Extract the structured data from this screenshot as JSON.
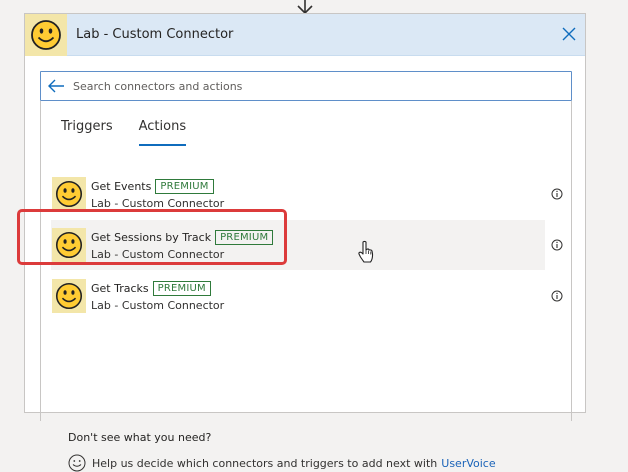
{
  "header": {
    "title": "Lab - Custom Connector"
  },
  "search": {
    "placeholder": "Search connectors and actions"
  },
  "tabs": [
    {
      "label": "Triggers"
    },
    {
      "label": "Actions"
    }
  ],
  "actions": [
    {
      "title": "Get Events",
      "badge": "PREMIUM",
      "connector": "Lab - Custom Connector"
    },
    {
      "title": "Get Sessions by Track",
      "badge": "PREMIUM",
      "connector": "Lab - Custom Connector"
    },
    {
      "title": "Get Tracks",
      "badge": "PREMIUM",
      "connector": "Lab - Custom Connector"
    }
  ],
  "footer": {
    "question": "Don't see what you need?",
    "help_text": "Help us decide which connectors and triggers to add next with",
    "link": "UserVoice"
  },
  "colors": {
    "accent": "#0f6cbd",
    "premium": "#2f7a3b",
    "highlight": "#dc3b3b",
    "header_bg": "#dbe8f5",
    "icon_bg": "#f3e6a9"
  },
  "icons": {
    "connector": "smiley-icon",
    "close": "close-icon",
    "back": "back-arrow-icon",
    "info": "info-icon",
    "feedback": "smiley-outline-icon"
  }
}
